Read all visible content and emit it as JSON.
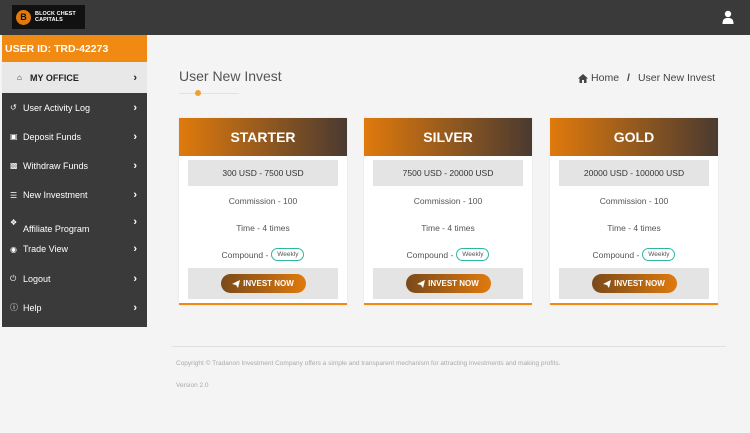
{
  "logo": {
    "line1": "BLOCK CHEST",
    "line2": "CAPITALS",
    "mark": "B"
  },
  "sidebar": {
    "user_id": "USER ID: TRD-42273",
    "office": {
      "label": "MY OFFICE",
      "icon": "home-icon"
    },
    "items": [
      {
        "label": "User Activity Log",
        "icon": "history-icon"
      },
      {
        "label": "Deposit Funds",
        "icon": "inbox-icon"
      },
      {
        "label": "Withdraw Funds",
        "icon": "money-icon"
      },
      {
        "label": "New Investment",
        "icon": "database-icon"
      },
      {
        "label": "Affiliate Program",
        "icon": "network-icon"
      },
      {
        "label": "Trade View",
        "icon": "globe-icon"
      },
      {
        "label": "Logout",
        "icon": "power-icon"
      },
      {
        "label": "Help",
        "icon": "info-icon"
      }
    ]
  },
  "page": {
    "title": "User New Invest",
    "breadcrumb": {
      "home": "Home",
      "separator": "/",
      "current": "User New Invest"
    }
  },
  "plans": [
    {
      "name": "STARTER",
      "range": "300 USD - 7500 USD",
      "commission": "Commission - 100",
      "time": "Time - 4 times",
      "compound_label": "Compound -",
      "compound_badge": "Weekly",
      "button": "INVEST NOW"
    },
    {
      "name": "SILVER",
      "range": "7500 USD - 20000 USD",
      "commission": "Commission - 100",
      "time": "Time - 4 times",
      "compound_label": "Compound -",
      "compound_badge": "Weekly",
      "button": "INVEST NOW"
    },
    {
      "name": "GOLD",
      "range": "20000 USD - 100000 USD",
      "commission": "Commission - 100",
      "time": "Time - 4 times",
      "compound_label": "Compound -",
      "compound_badge": "Weekly",
      "button": "INVEST NOW"
    }
  ],
  "footer": {
    "copyright": "Copyright © Tradanon Investment Company offers a simple and transparent mechanism for attracting investments and making profits.",
    "version": "Version 2.0"
  },
  "colors": {
    "accent": "#f08a12",
    "dark": "#3a3a3a",
    "badge_border": "#2eb8a0"
  }
}
